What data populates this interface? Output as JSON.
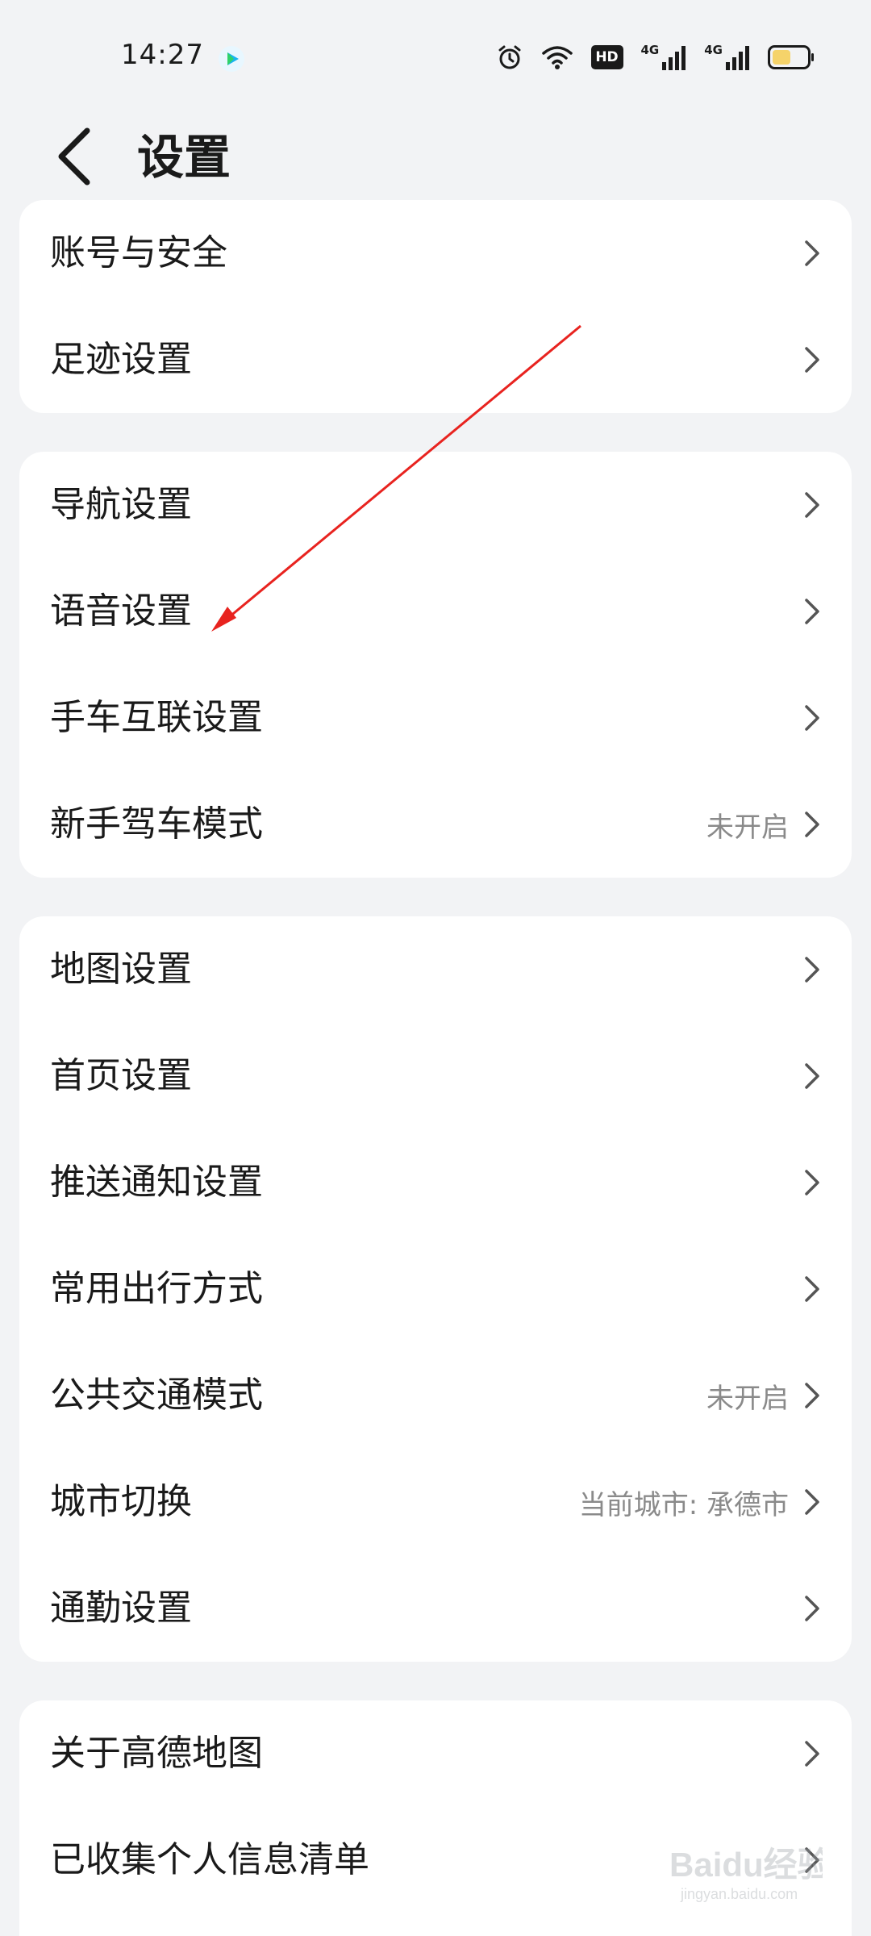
{
  "status_bar": {
    "time": "14:27",
    "icons": [
      "video-app-icon",
      "alarm-icon",
      "wifi-icon",
      "hd-voice-icon",
      "signal-4g-icon",
      "signal-4g-icon",
      "battery-icon"
    ],
    "hd_label": "HD",
    "net_label_1": "4G",
    "net_label_2": "4G"
  },
  "header": {
    "title": "设置",
    "back_icon": "chevron-left-icon"
  },
  "groups": [
    {
      "items": [
        {
          "label": "账号与安全",
          "value": ""
        },
        {
          "label": "足迹设置",
          "value": ""
        }
      ]
    },
    {
      "items": [
        {
          "label": "导航设置",
          "value": ""
        },
        {
          "label": "语音设置",
          "value": ""
        },
        {
          "label": "手车互联设置",
          "value": ""
        },
        {
          "label": "新手驾车模式",
          "value": "未开启"
        }
      ]
    },
    {
      "items": [
        {
          "label": "地图设置",
          "value": ""
        },
        {
          "label": "首页设置",
          "value": ""
        },
        {
          "label": "推送通知设置",
          "value": ""
        },
        {
          "label": "常用出行方式",
          "value": ""
        },
        {
          "label": "公共交通模式",
          "value": "未开启"
        },
        {
          "label": "城市切换",
          "value": "当前城市: 承德市"
        },
        {
          "label": "通勤设置",
          "value": ""
        }
      ]
    },
    {
      "items": [
        {
          "label": "关于高德地图",
          "value": ""
        },
        {
          "label": "已收集个人信息清单",
          "value": ""
        }
      ]
    }
  ],
  "colors": {
    "background": "#f2f3f5",
    "card": "#ffffff",
    "text": "#1a1a1a",
    "secondary_text": "#8a8a8a",
    "annotation_arrow": "#e8231f"
  },
  "watermark": {
    "text": "Baidu经验",
    "sub": "jingyan.baidu.com"
  }
}
